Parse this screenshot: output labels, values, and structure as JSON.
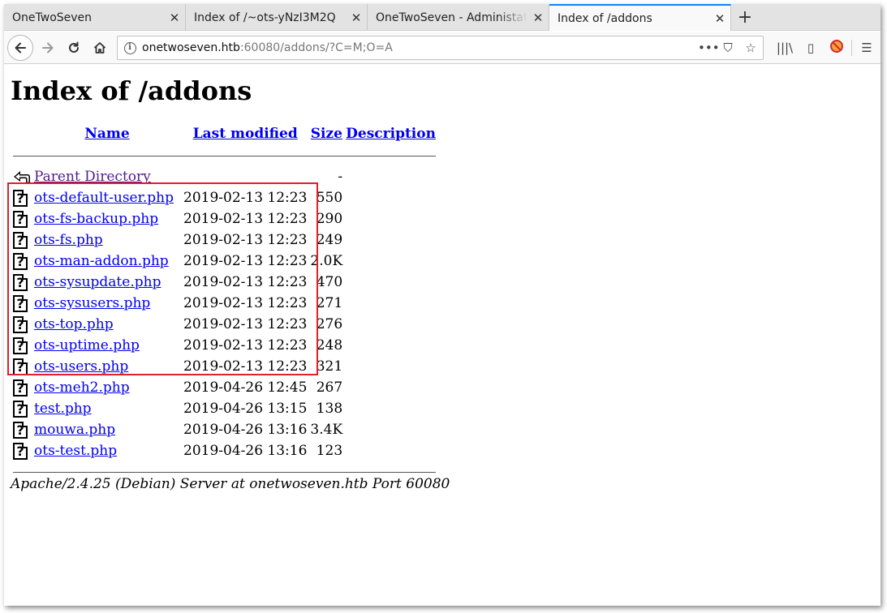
{
  "tabs": [
    {
      "title": "OneTwoSeven",
      "active": false
    },
    {
      "title": "Index of /~ots-yNzI3M2Q",
      "active": false
    },
    {
      "title": "OneTwoSeven - Administati",
      "active": false
    },
    {
      "title": "Index of /addons",
      "active": true
    }
  ],
  "tab_close_glyph": "✕",
  "new_tab_glyph": "+",
  "nav": {
    "url_host": "onetwoseven.htb",
    "url_rest": ":60080/addons/?C=M;O=A",
    "info_glyph": "i",
    "actions": {
      "more": "•••",
      "pocket": "⛉",
      "star": "☆"
    },
    "right": {
      "library": "|||\\",
      "sidebar": "▯",
      "blocked": "⊘",
      "menu": "☰"
    }
  },
  "page": {
    "heading": "Index of /addons",
    "columns": {
      "name": "Name",
      "last_modified": "Last modified",
      "size": "Size",
      "description": "Description"
    },
    "parent": {
      "name": "Parent Directory",
      "size": "-",
      "icon": "back-icon"
    },
    "files": [
      {
        "name": "ots-default-user.php",
        "modified": "2019-02-13 12:23",
        "size": "550",
        "icon": "unknown-file-icon"
      },
      {
        "name": "ots-fs-backup.php",
        "modified": "2019-02-13 12:23",
        "size": "290",
        "icon": "unknown-file-icon"
      },
      {
        "name": "ots-fs.php",
        "modified": "2019-02-13 12:23",
        "size": "249",
        "icon": "unknown-file-icon"
      },
      {
        "name": "ots-man-addon.php",
        "modified": "2019-02-13 12:23",
        "size": "2.0K",
        "icon": "unknown-file-icon"
      },
      {
        "name": "ots-sysupdate.php",
        "modified": "2019-02-13 12:23",
        "size": "470",
        "icon": "unknown-file-icon"
      },
      {
        "name": "ots-sysusers.php",
        "modified": "2019-02-13 12:23",
        "size": "271",
        "icon": "unknown-file-icon"
      },
      {
        "name": "ots-top.php",
        "modified": "2019-02-13 12:23",
        "size": "276",
        "icon": "unknown-file-icon"
      },
      {
        "name": "ots-uptime.php",
        "modified": "2019-02-13 12:23",
        "size": "248",
        "icon": "unknown-file-icon"
      },
      {
        "name": "ots-users.php",
        "modified": "2019-02-13 12:23",
        "size": "321",
        "icon": "unknown-file-icon"
      },
      {
        "name": "ots-meh2.php",
        "modified": "2019-04-26 12:45",
        "size": "267",
        "icon": "unknown-file-icon"
      },
      {
        "name": "test.php",
        "modified": "2019-04-26 13:15",
        "size": "138",
        "icon": "unknown-file-icon"
      },
      {
        "name": "mouwa.php",
        "modified": "2019-04-26 13:16",
        "size": "3.4K",
        "icon": "unknown-file-icon"
      },
      {
        "name": "ots-test.php",
        "modified": "2019-04-26 13:16",
        "size": "123",
        "icon": "unknown-file-icon"
      }
    ],
    "file_icon_glyph": "?",
    "footer": "Apache/2.4.25 (Debian) Server at onetwoseven.htb Port 60080"
  },
  "colors": {
    "link": "#0000ee",
    "visited": "#551a8b",
    "highlight": "#e0202a",
    "tab_accent": "#0a84ff"
  }
}
